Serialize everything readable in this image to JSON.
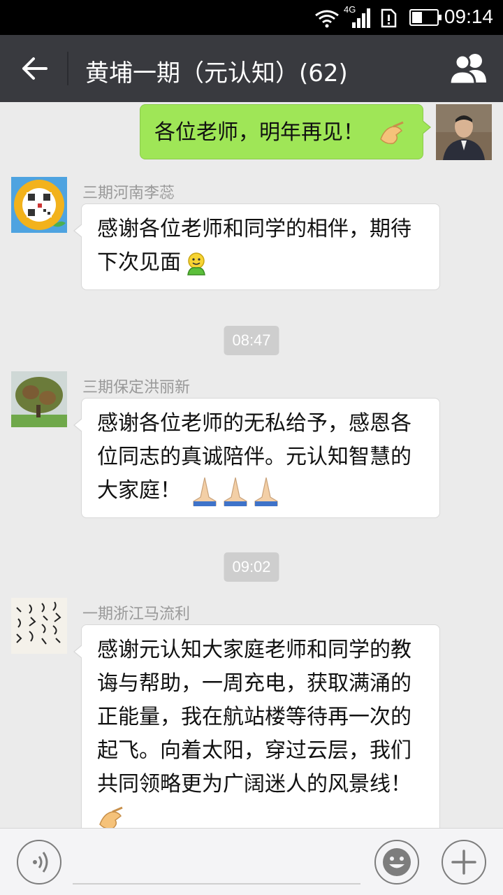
{
  "status_bar": {
    "network": "4G",
    "time": "09:14",
    "icons": [
      "wifi-icon",
      "signal-icon",
      "sim-alert-icon",
      "battery-icon"
    ]
  },
  "header": {
    "back_icon": "back-arrow-icon",
    "title": "黄埔一期（元认知）(62)",
    "members_icon": "group-members-icon"
  },
  "messages": [
    {
      "sender": "",
      "mine": true,
      "text": "各位老师，明年再见！",
      "emoji": "ok-hand-emoji"
    },
    {
      "sender": "三期河南李蕊",
      "mine": false,
      "lines": [
        "感谢各位老师和同学的相伴，期待",
        "下次见面"
      ],
      "emoji": "green-smiley-emoji"
    },
    {
      "timestamp": "08:47"
    },
    {
      "sender": "三期保定洪丽新",
      "mine": false,
      "lines": [
        "感谢各位老师的无私给予，感恩各",
        "位同志的真诚陪伴。元认知智慧的",
        "大家庭！"
      ],
      "emoji": "praying-hands-emoji"
    },
    {
      "timestamp": "09:02"
    },
    {
      "sender": "一期浙江马流利",
      "mine": false,
      "lines": [
        "感谢元认知大家庭老师和同学的教",
        "诲与帮助，一周充电，获取满涌的",
        "正能量，我在航站楼等待再一次的",
        "起飞。向着太阳，穿过云层，我们",
        "共同领略更为广阔迷人的风景线！"
      ],
      "emoji": "ok-hand-emoji"
    }
  ],
  "input_bar": {
    "voice_icon": "voice-icon",
    "emoji_icon": "emoji-icon",
    "plus_icon": "plus-icon"
  }
}
